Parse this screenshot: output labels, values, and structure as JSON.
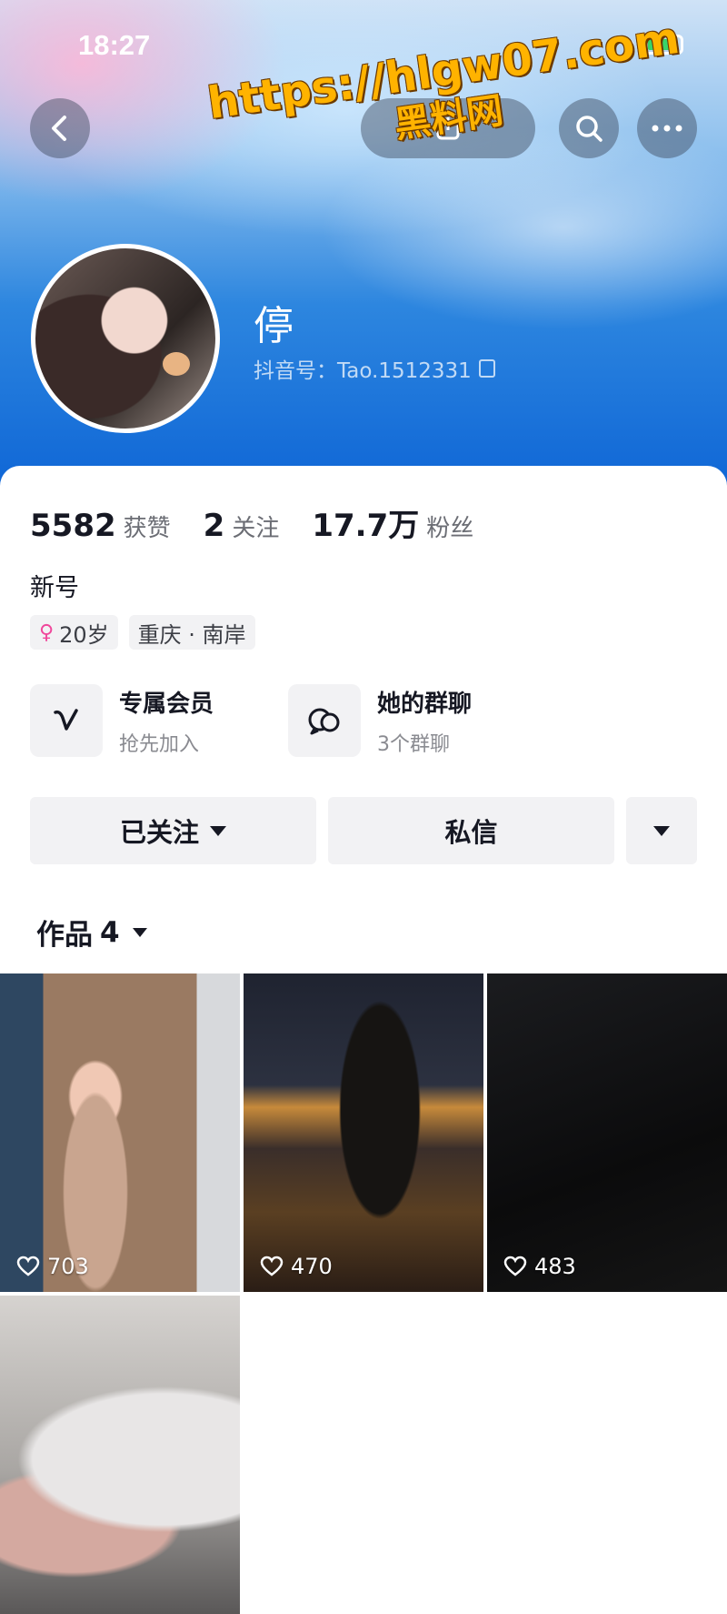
{
  "status_bar": {
    "time": "18:27"
  },
  "watermark": {
    "line1": "https://hlgw07.com",
    "line2": "黑料网"
  },
  "profile": {
    "nickname": "停",
    "douyin_id": "抖音号：Tao.1512331"
  },
  "stats": {
    "likes": {
      "value": "5582",
      "label": "获赞"
    },
    "following": {
      "value": "2",
      "label": "关注"
    },
    "followers": {
      "value": "17.7万",
      "label": "粉丝"
    }
  },
  "bio": "新号",
  "tags": {
    "age": "20岁",
    "location": "重庆 · 南岸"
  },
  "features": [
    {
      "title": "专属会员",
      "subtitle": "抢先加入",
      "icon": "v-icon"
    },
    {
      "title": "她的群聊",
      "subtitle": "3个群聊",
      "icon": "chat-bubbles-icon"
    }
  ],
  "actions": {
    "followed": "已关注",
    "message": "私信"
  },
  "works": {
    "label": "作品",
    "count": "4"
  },
  "videos": [
    {
      "likes": "703"
    },
    {
      "likes": "470"
    },
    {
      "likes": "483"
    },
    {
      "likes": ""
    }
  ],
  "colors": {
    "accent_blue": "#0f66d6",
    "female_pink": "#f0479b",
    "watermark": "#ffb300"
  }
}
